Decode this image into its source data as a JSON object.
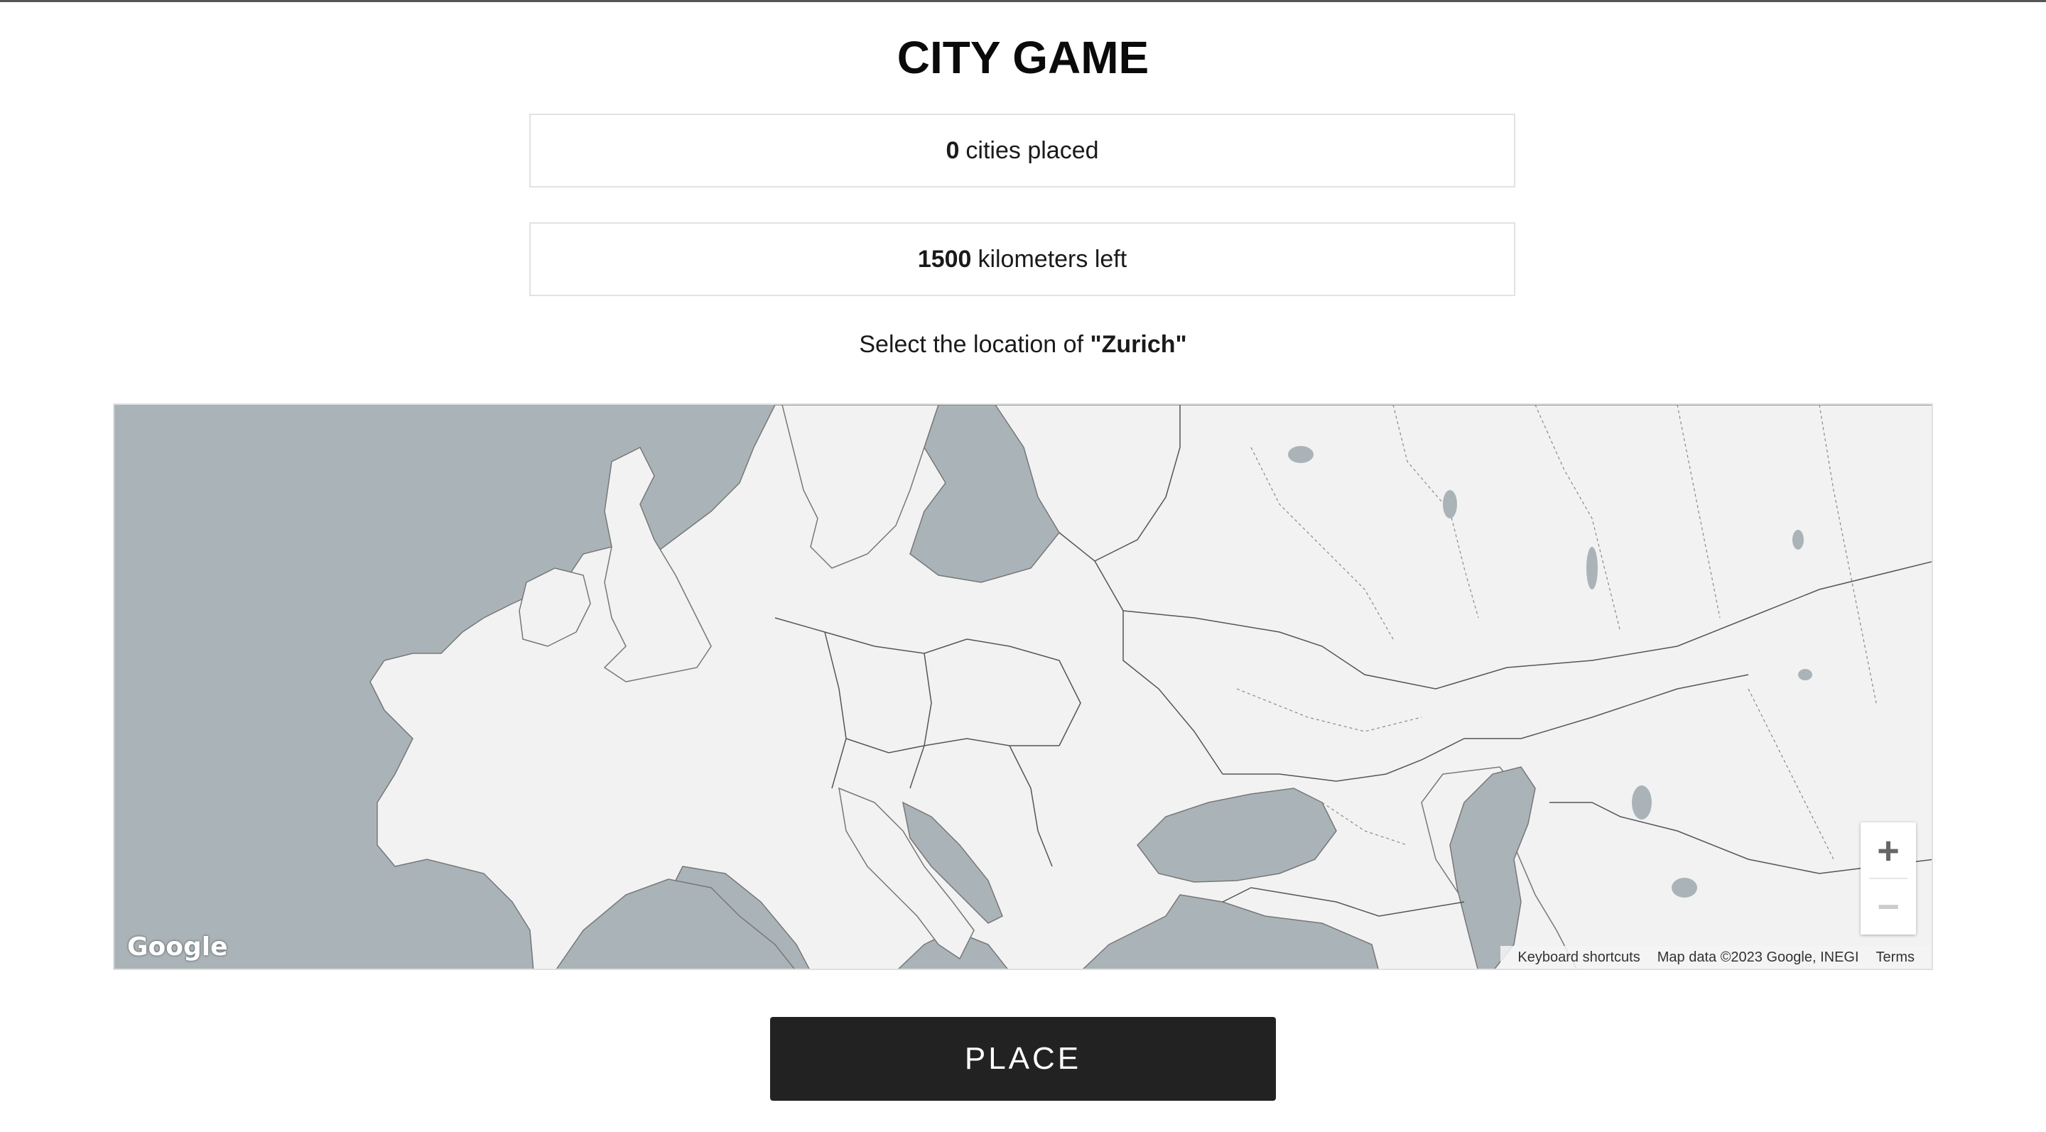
{
  "title": "CITY GAME",
  "stats": {
    "cities_count": "0",
    "cities_label": "cities placed",
    "km_count": "1500",
    "km_label": "kilometers left"
  },
  "prompt": {
    "prefix": "Select the location of",
    "city": "\"Zurich\""
  },
  "map": {
    "logo": "Google",
    "zoom_in": "+",
    "zoom_out": "−",
    "attribution": {
      "shortcuts": "Keyboard shortcuts",
      "data": "Map data ©2023 Google, INEGI",
      "terms": "Terms"
    },
    "colors": {
      "water": "#aab4b8",
      "land": "#f2f2f2",
      "border": "#555555"
    }
  },
  "place_button": "PLACE"
}
